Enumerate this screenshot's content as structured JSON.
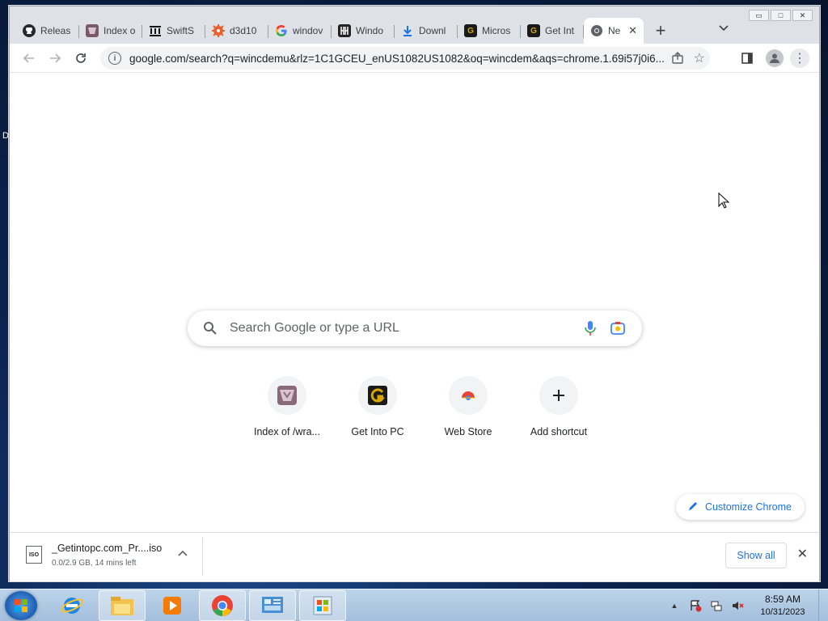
{
  "desktop": {
    "edge_text": "D"
  },
  "window_controls": {
    "minimize": "▭",
    "maximize": "□",
    "close": "✕"
  },
  "tabs": [
    {
      "label": "Releas",
      "icon": "github-icon",
      "color": "#24292f",
      "glyph": ""
    },
    {
      "label": "Index o",
      "icon": "wrapper-icon",
      "color": "#7a5a6a",
      "glyph": ""
    },
    {
      "label": "SwiftS",
      "icon": "bank-icon",
      "color": "#111111",
      "glyph": ""
    },
    {
      "label": "d3d10",
      "icon": "gear-icon",
      "color": "#e8612c",
      "glyph": ""
    },
    {
      "label": "windov",
      "icon": "google-icon",
      "color": "#ffffff",
      "glyph": "G"
    },
    {
      "label": "Windo",
      "icon": "windows-h-icon",
      "color": "#222222",
      "glyph": ""
    },
    {
      "label": "Downl",
      "icon": "download-icon",
      "color": "#ffffff",
      "glyph": ""
    },
    {
      "label": "Micros",
      "icon": "getintopc-icon",
      "color": "#1a1a1a",
      "glyph": "G"
    },
    {
      "label": "Get Int",
      "icon": "getintopc-icon",
      "color": "#1a1a1a",
      "glyph": "G"
    },
    {
      "label": "Ne",
      "icon": "chrome-icon",
      "color": "#ffffff",
      "glyph": "",
      "active": true
    }
  ],
  "new_tab_label": "+",
  "tab_search_label": "⌄",
  "toolbar": {
    "back": "←",
    "forward": "→",
    "reload": "↻",
    "info": "i",
    "url": "google.com/search?q=wincdemu&rlz=1C1GCEU_enUS1082US1082&oq=wincdem&aqs=chrome.1.69i57j0i6...",
    "share": "⇪",
    "star": "☆",
    "sidepanel": "▮",
    "avatar": "●",
    "menu": "⋮"
  },
  "ntp": {
    "search_placeholder": "Search Google or type a URL",
    "shortcuts": [
      {
        "label": "Index of /wra...",
        "icon": "wrapper-icon"
      },
      {
        "label": "Get Into PC",
        "icon": "getintopc-icon"
      },
      {
        "label": "Web Store",
        "icon": "webstore-icon"
      },
      {
        "label": "Add shortcut",
        "icon": "plus-icon"
      }
    ],
    "customize_label": "Customize Chrome",
    "customize_icon": "✎"
  },
  "download": {
    "file_type": "ISO",
    "name": "_Getintopc.com_Pr....iso",
    "status": "0.0/2.9 GB, 14 mins left",
    "chevron": "⌃",
    "show_all": "Show all",
    "close": "✕"
  },
  "taskbar": {
    "time": "8:59 AM",
    "date": "10/31/2023",
    "tray_up": "▲"
  }
}
